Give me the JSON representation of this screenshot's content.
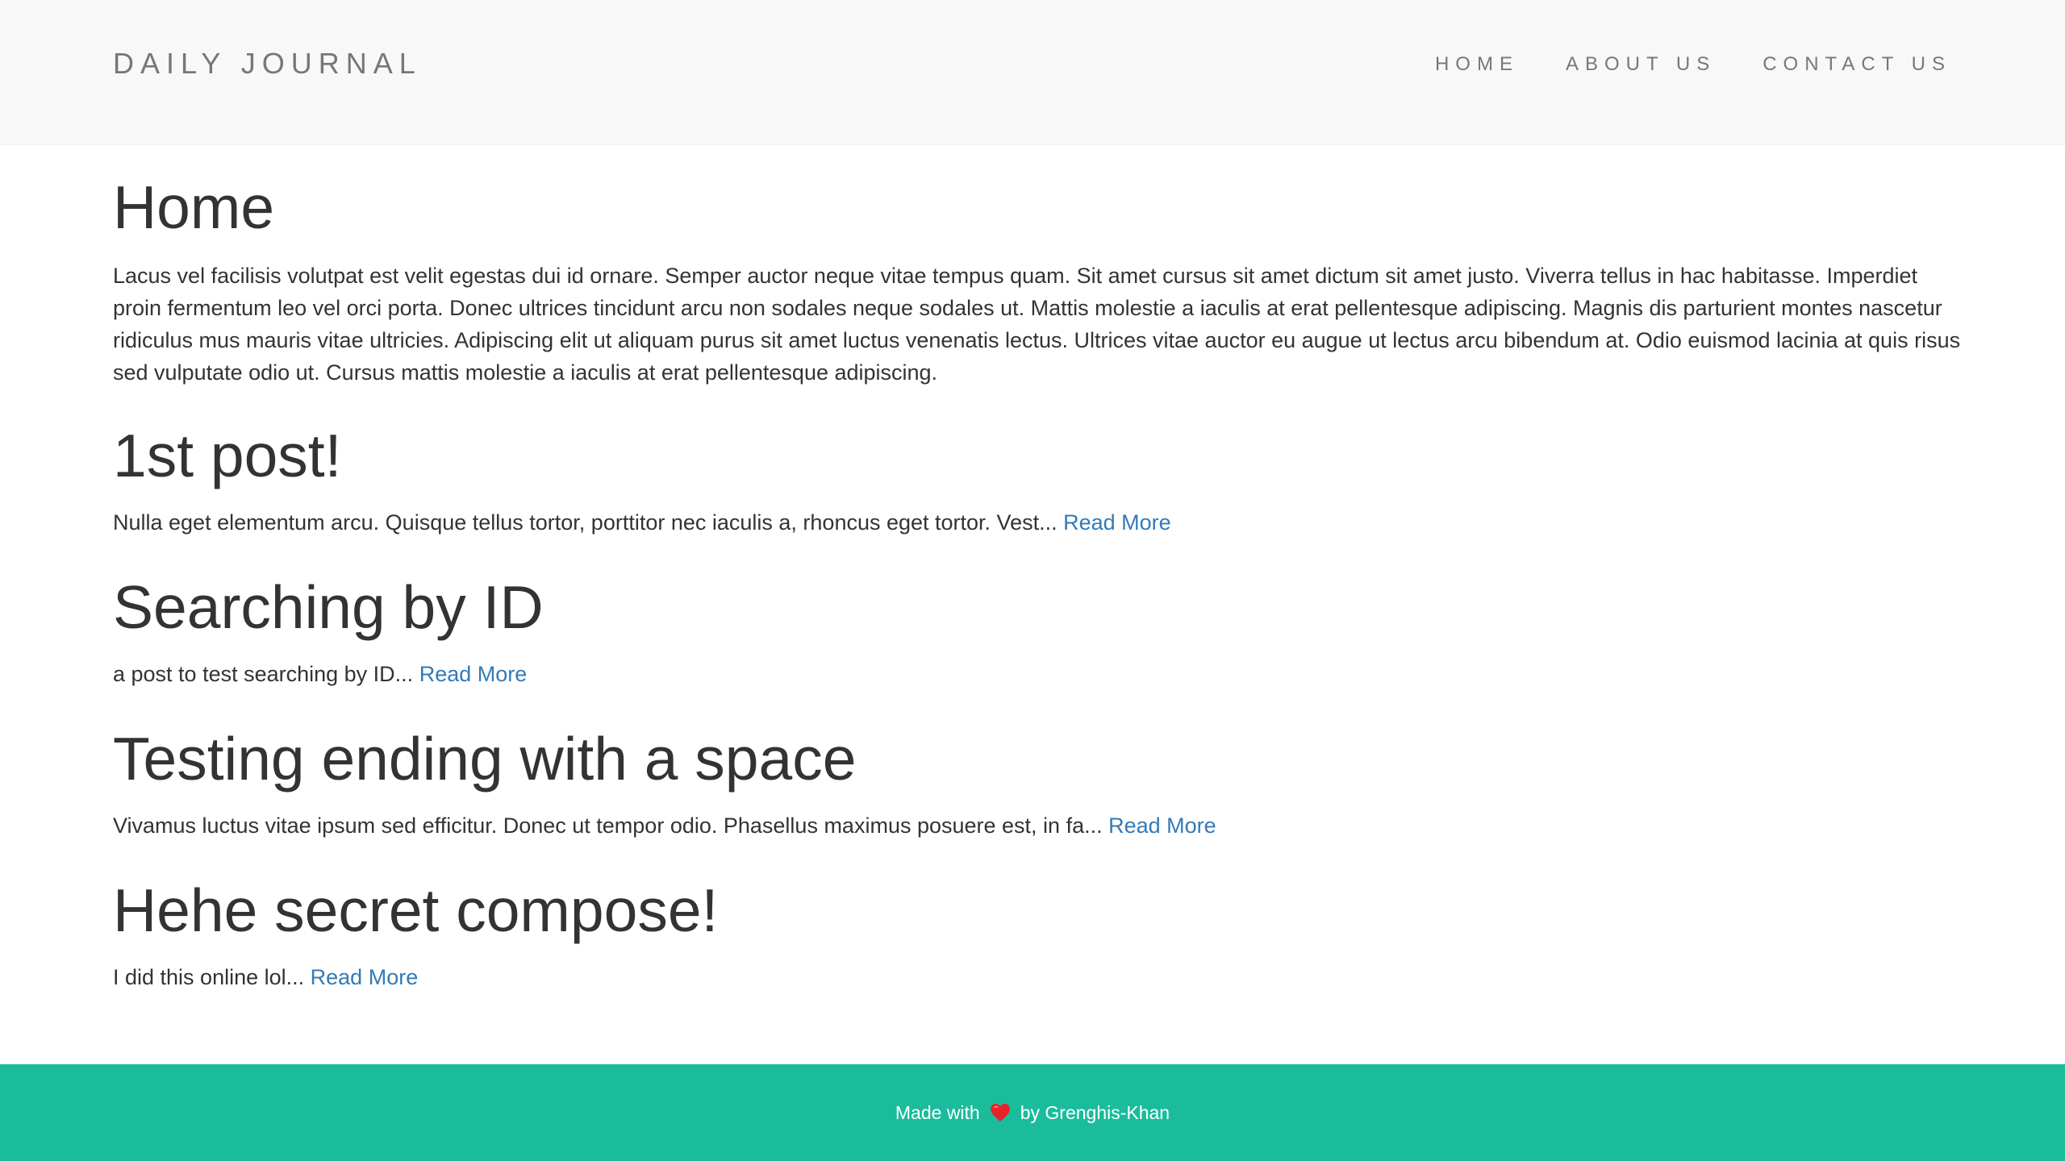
{
  "header": {
    "brand": "DAILY JOURNAL",
    "nav": [
      {
        "label": "HOME"
      },
      {
        "label": "ABOUT US"
      },
      {
        "label": "CONTACT US"
      }
    ]
  },
  "main": {
    "title": "Home",
    "intro": "Lacus vel facilisis volutpat est velit egestas dui id ornare. Semper auctor neque vitae tempus quam. Sit amet cursus sit amet dictum sit amet justo. Viverra tellus in hac habitasse. Imperdiet proin fermentum leo vel orci porta. Donec ultrices tincidunt arcu non sodales neque sodales ut. Mattis molestie a iaculis at erat pellentesque adipiscing. Magnis dis parturient montes nascetur ridiculus mus mauris vitae ultricies. Adipiscing elit ut aliquam purus sit amet luctus venenatis lectus. Ultrices vitae auctor eu augue ut lectus arcu bibendum at. Odio euismod lacinia at quis risus sed vulputate odio ut. Cursus mattis molestie a iaculis at erat pellentesque adipiscing.",
    "posts": [
      {
        "title": "1st post!",
        "excerpt": "Nulla eget elementum arcu. Quisque tellus tortor, porttitor nec iaculis a, rhoncus eget tortor. Vest...",
        "link": "Read More"
      },
      {
        "title": "Searching by ID",
        "excerpt": "a post to test searching by ID...",
        "link": "Read More"
      },
      {
        "title": "Testing ending with a space",
        "excerpt": "Vivamus luctus vitae ipsum sed efficitur. Donec ut tempor odio. Phasellus maximus posuere est, in fa...",
        "link": "Read More"
      },
      {
        "title": "Hehe secret compose!",
        "excerpt": "I did this online lol...",
        "link": "Read More"
      }
    ]
  },
  "footer": {
    "made_with": "Made with",
    "icon": "heart-icon",
    "by": "by Grenghis-Khan"
  },
  "colors": {
    "navbar_bg": "#f8f8f8",
    "link": "#337ab7",
    "footer_bg": "#1abc9c",
    "heart": "#e8222a"
  }
}
